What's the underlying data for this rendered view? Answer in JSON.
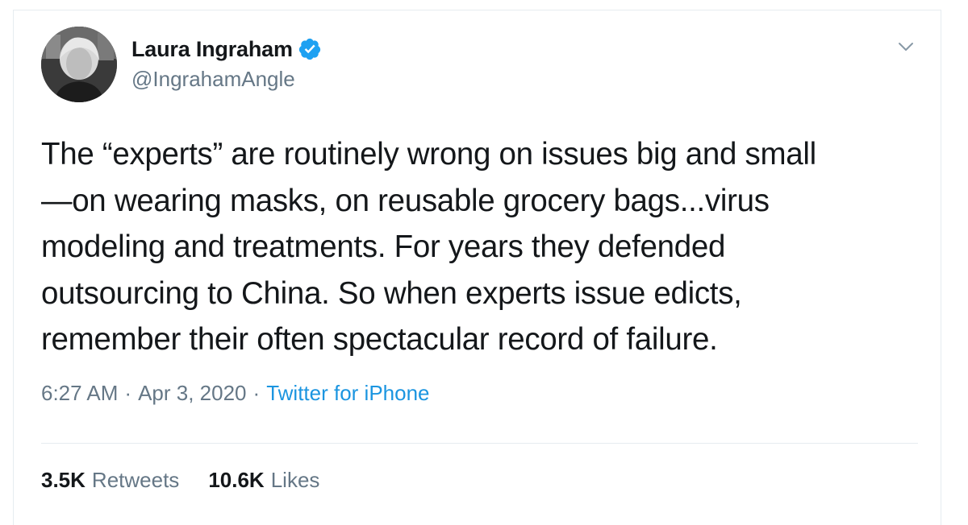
{
  "author": {
    "name": "Laura Ingraham",
    "handle": "@IngrahamAngle",
    "verified": true
  },
  "tweet": {
    "lines": [
      "The “experts” are routinely wrong on issues big and small",
      "—on wearing masks, on reusable grocery bags...virus",
      "modeling and treatments. For years they defended",
      "outsourcing to China. So when experts issue edicts,",
      "remember their often spectacular record of failure."
    ]
  },
  "meta": {
    "time": "6:27 AM",
    "separator": "·",
    "date": "Apr 3, 2020",
    "source": "Twitter for iPhone"
  },
  "stats": {
    "retweets_count": "3.5K",
    "retweets_label": "Retweets",
    "likes_count": "10.6K",
    "likes_label": "Likes"
  },
  "icons": {
    "verified": "verified-badge-icon",
    "menu": "chevron-down-icon"
  },
  "colors": {
    "text": "#14171a",
    "secondary": "#657786",
    "link": "#1b95e0",
    "verified": "#1da1f2",
    "border": "#e6ecf0"
  }
}
